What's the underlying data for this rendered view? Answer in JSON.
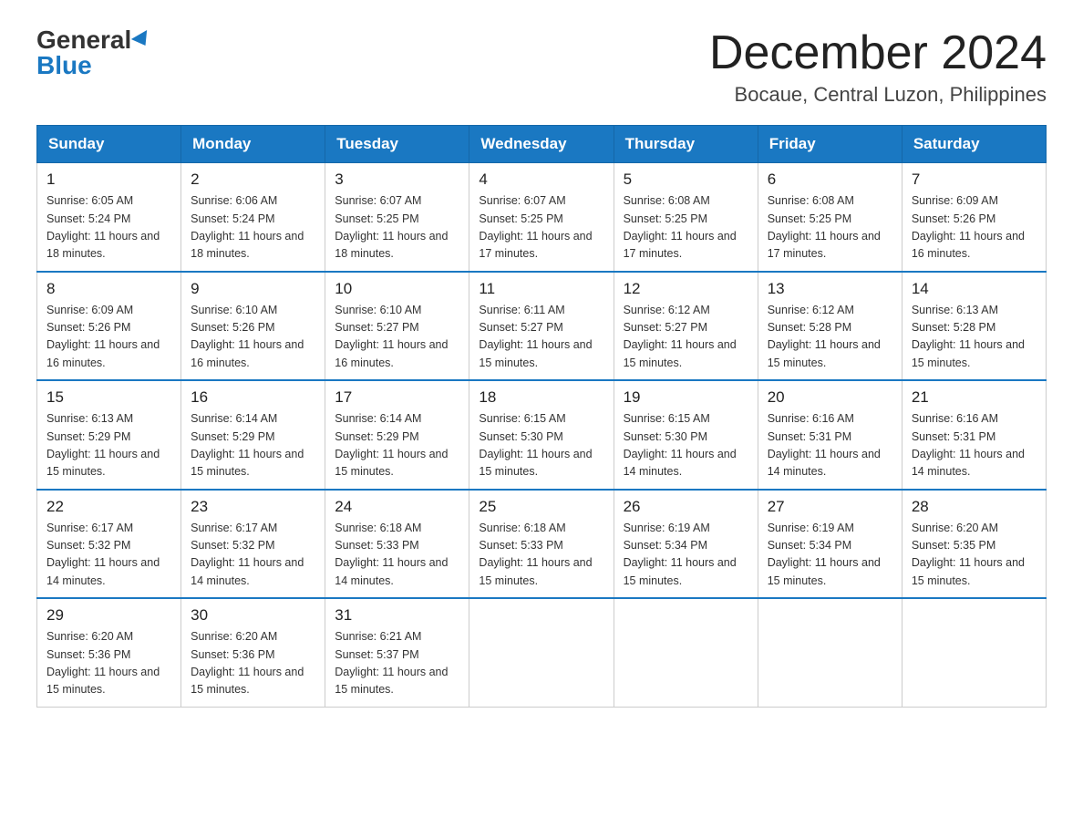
{
  "header": {
    "logo_general": "General",
    "logo_blue": "Blue",
    "month_title": "December 2024",
    "location": "Bocaue, Central Luzon, Philippines"
  },
  "weekdays": [
    "Sunday",
    "Monday",
    "Tuesday",
    "Wednesday",
    "Thursday",
    "Friday",
    "Saturday"
  ],
  "weeks": [
    [
      {
        "day": "1",
        "sunrise": "6:05 AM",
        "sunset": "5:24 PM",
        "daylight": "11 hours and 18 minutes."
      },
      {
        "day": "2",
        "sunrise": "6:06 AM",
        "sunset": "5:24 PM",
        "daylight": "11 hours and 18 minutes."
      },
      {
        "day": "3",
        "sunrise": "6:07 AM",
        "sunset": "5:25 PM",
        "daylight": "11 hours and 18 minutes."
      },
      {
        "day": "4",
        "sunrise": "6:07 AM",
        "sunset": "5:25 PM",
        "daylight": "11 hours and 17 minutes."
      },
      {
        "day": "5",
        "sunrise": "6:08 AM",
        "sunset": "5:25 PM",
        "daylight": "11 hours and 17 minutes."
      },
      {
        "day": "6",
        "sunrise": "6:08 AM",
        "sunset": "5:25 PM",
        "daylight": "11 hours and 17 minutes."
      },
      {
        "day": "7",
        "sunrise": "6:09 AM",
        "sunset": "5:26 PM",
        "daylight": "11 hours and 16 minutes."
      }
    ],
    [
      {
        "day": "8",
        "sunrise": "6:09 AM",
        "sunset": "5:26 PM",
        "daylight": "11 hours and 16 minutes."
      },
      {
        "day": "9",
        "sunrise": "6:10 AM",
        "sunset": "5:26 PM",
        "daylight": "11 hours and 16 minutes."
      },
      {
        "day": "10",
        "sunrise": "6:10 AM",
        "sunset": "5:27 PM",
        "daylight": "11 hours and 16 minutes."
      },
      {
        "day": "11",
        "sunrise": "6:11 AM",
        "sunset": "5:27 PM",
        "daylight": "11 hours and 15 minutes."
      },
      {
        "day": "12",
        "sunrise": "6:12 AM",
        "sunset": "5:27 PM",
        "daylight": "11 hours and 15 minutes."
      },
      {
        "day": "13",
        "sunrise": "6:12 AM",
        "sunset": "5:28 PM",
        "daylight": "11 hours and 15 minutes."
      },
      {
        "day": "14",
        "sunrise": "6:13 AM",
        "sunset": "5:28 PM",
        "daylight": "11 hours and 15 minutes."
      }
    ],
    [
      {
        "day": "15",
        "sunrise": "6:13 AM",
        "sunset": "5:29 PM",
        "daylight": "11 hours and 15 minutes."
      },
      {
        "day": "16",
        "sunrise": "6:14 AM",
        "sunset": "5:29 PM",
        "daylight": "11 hours and 15 minutes."
      },
      {
        "day": "17",
        "sunrise": "6:14 AM",
        "sunset": "5:29 PM",
        "daylight": "11 hours and 15 minutes."
      },
      {
        "day": "18",
        "sunrise": "6:15 AM",
        "sunset": "5:30 PM",
        "daylight": "11 hours and 15 minutes."
      },
      {
        "day": "19",
        "sunrise": "6:15 AM",
        "sunset": "5:30 PM",
        "daylight": "11 hours and 14 minutes."
      },
      {
        "day": "20",
        "sunrise": "6:16 AM",
        "sunset": "5:31 PM",
        "daylight": "11 hours and 14 minutes."
      },
      {
        "day": "21",
        "sunrise": "6:16 AM",
        "sunset": "5:31 PM",
        "daylight": "11 hours and 14 minutes."
      }
    ],
    [
      {
        "day": "22",
        "sunrise": "6:17 AM",
        "sunset": "5:32 PM",
        "daylight": "11 hours and 14 minutes."
      },
      {
        "day": "23",
        "sunrise": "6:17 AM",
        "sunset": "5:32 PM",
        "daylight": "11 hours and 14 minutes."
      },
      {
        "day": "24",
        "sunrise": "6:18 AM",
        "sunset": "5:33 PM",
        "daylight": "11 hours and 14 minutes."
      },
      {
        "day": "25",
        "sunrise": "6:18 AM",
        "sunset": "5:33 PM",
        "daylight": "11 hours and 15 minutes."
      },
      {
        "day": "26",
        "sunrise": "6:19 AM",
        "sunset": "5:34 PM",
        "daylight": "11 hours and 15 minutes."
      },
      {
        "day": "27",
        "sunrise": "6:19 AM",
        "sunset": "5:34 PM",
        "daylight": "11 hours and 15 minutes."
      },
      {
        "day": "28",
        "sunrise": "6:20 AM",
        "sunset": "5:35 PM",
        "daylight": "11 hours and 15 minutes."
      }
    ],
    [
      {
        "day": "29",
        "sunrise": "6:20 AM",
        "sunset": "5:36 PM",
        "daylight": "11 hours and 15 minutes."
      },
      {
        "day": "30",
        "sunrise": "6:20 AM",
        "sunset": "5:36 PM",
        "daylight": "11 hours and 15 minutes."
      },
      {
        "day": "31",
        "sunrise": "6:21 AM",
        "sunset": "5:37 PM",
        "daylight": "11 hours and 15 minutes."
      },
      null,
      null,
      null,
      null
    ]
  ]
}
